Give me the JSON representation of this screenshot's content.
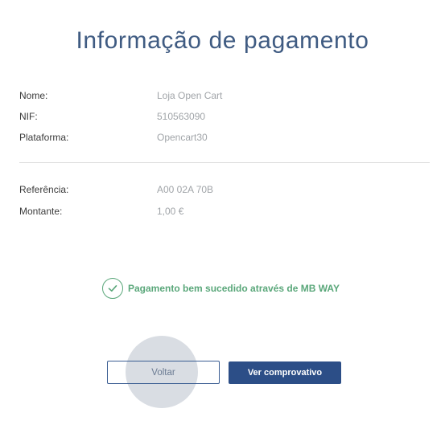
{
  "header": {
    "title": "Informação de pagamento"
  },
  "merchant": {
    "name_label": "Nome:",
    "name_value": "Loja Open Cart",
    "nif_label": "NIF:",
    "nif_value": "510563090",
    "platform_label": "Plataforma:",
    "platform_value": "Opencart30"
  },
  "payment": {
    "reference_label": "Referência:",
    "reference_value": "A00 02A 70B",
    "amount_label": "Montante:",
    "amount_value": "1,00 €"
  },
  "status": {
    "message": "Pagamento bem sucedido através de MB WAY",
    "icon": "check-circle-icon",
    "color": "#5aa77a"
  },
  "actions": {
    "back_label": "Voltar",
    "receipt_label": "Ver comprovativo",
    "primary_color": "#2c4e87"
  }
}
